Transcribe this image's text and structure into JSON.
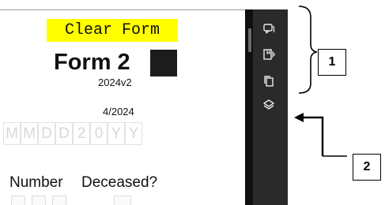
{
  "form": {
    "clear_button": "Clear Form",
    "title": "Form 2",
    "revision": "2024v2",
    "revision_date": "4/2024",
    "date_mask": [
      "M",
      "M",
      "D",
      "D",
      "2",
      "0",
      "Y",
      "Y"
    ],
    "col_number": "Number",
    "col_deceased": "Deceased?"
  },
  "toolbar": {
    "icons": [
      "comment-icon",
      "bookmark-panel-icon",
      "copy-pages-icon",
      "layers-icon"
    ]
  },
  "callouts": {
    "label_1": "1",
    "label_2": "2"
  },
  "colors": {
    "clear_button_bg": "#ffff00",
    "toolbar_bg": "#2a2a2a",
    "gutter_bg": "#101010"
  }
}
